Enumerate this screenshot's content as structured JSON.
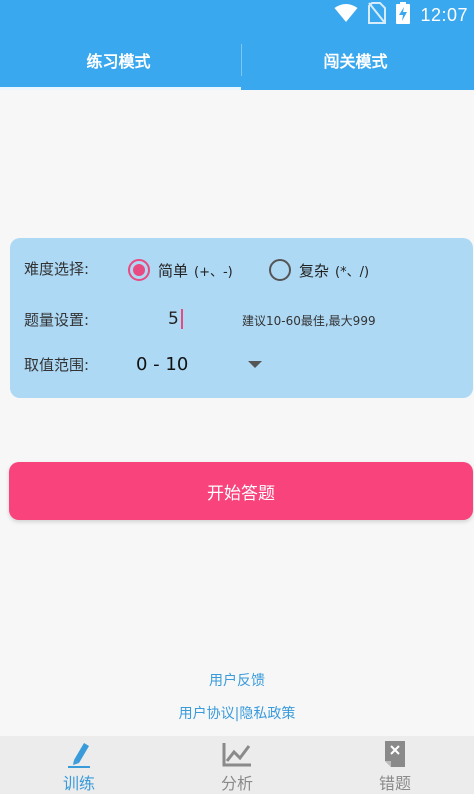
{
  "status_bar": {
    "time": "12:07"
  },
  "tabs": [
    {
      "label": "练习模式"
    },
    {
      "label": "闯关模式"
    }
  ],
  "settings": {
    "difficulty_label": "难度选择:",
    "difficulty_options": [
      {
        "text": "简单",
        "hint": "(+、-)",
        "selected": true
      },
      {
        "text": "复杂",
        "hint": "(*、/)",
        "selected": false
      }
    ],
    "count_label": "题量设置:",
    "count_value": "5",
    "count_hint": "建议10-60最佳,最大999",
    "range_label": "取值范围:",
    "range_value": "0 - 10"
  },
  "start_button": "开始答题",
  "links": {
    "feedback": "用户反馈",
    "agreement": "用户协议|隐私政策"
  },
  "bottom_nav": [
    {
      "label": "训练",
      "icon": "pencil-icon",
      "active": true
    },
    {
      "label": "分析",
      "icon": "chart-icon",
      "active": false
    },
    {
      "label": "错题",
      "icon": "wrong-note-icon",
      "active": false
    }
  ],
  "colors": {
    "header": "#3aa8ee",
    "accent_pink": "#f8437c",
    "card": "#aed9f5",
    "link": "#3a9bdb",
    "nav_active": "#3a9bdb",
    "nav_inactive": "#8a8a8a"
  }
}
